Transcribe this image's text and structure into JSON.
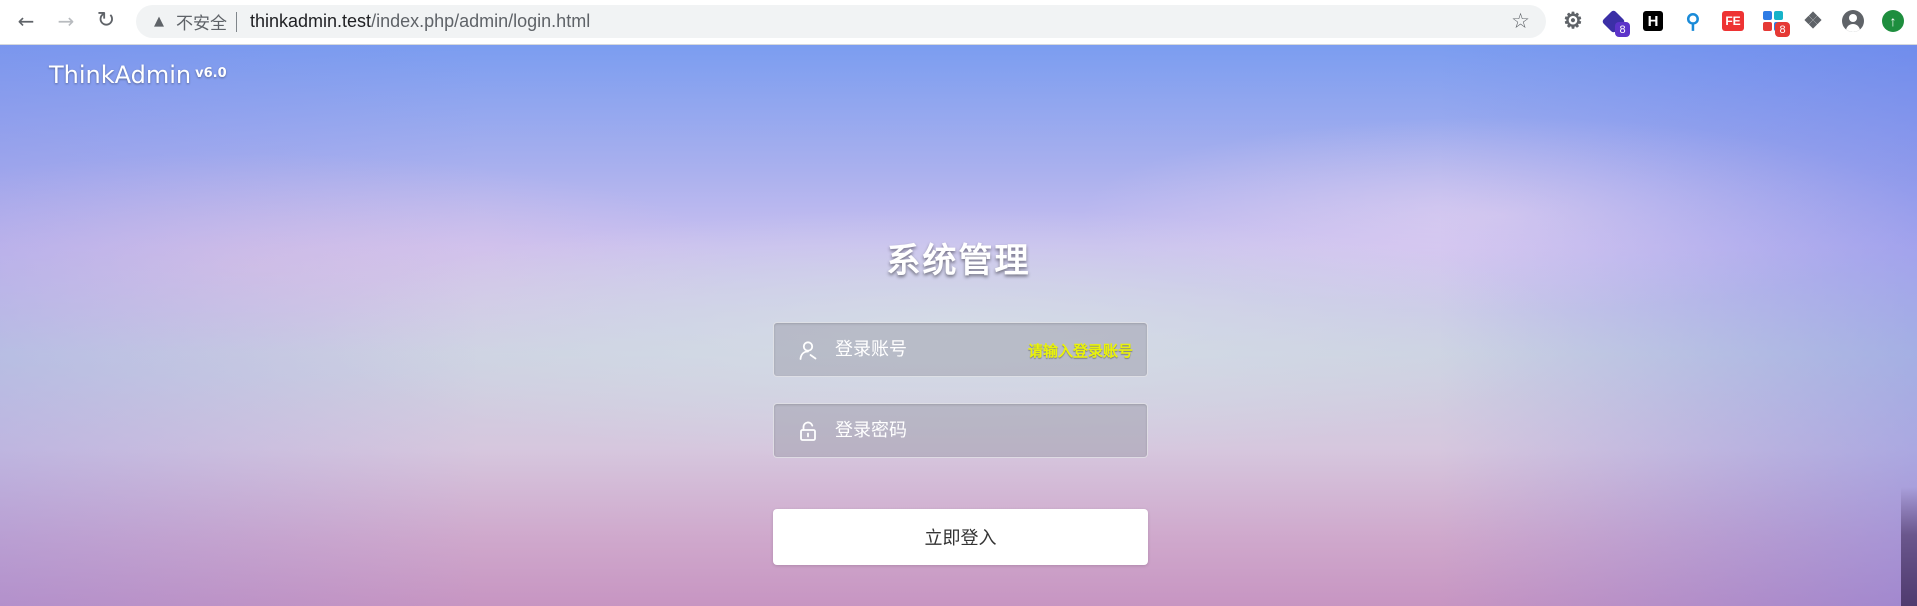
{
  "browser": {
    "security_label": "不安全",
    "url_host": "thinkadmin.test",
    "url_path": "/index.php/admin/login.html",
    "extensions": [
      {
        "name": "settings-extension",
        "badge": ""
      },
      {
        "name": "cube-extension",
        "badge": "8",
        "badge_color": "#5c33c9"
      },
      {
        "name": "h-extension",
        "label": "H",
        "badge": ""
      },
      {
        "name": "pin-extension",
        "badge": ""
      },
      {
        "name": "fe-extension",
        "label": "FE",
        "badge": ""
      },
      {
        "name": "grid-extension",
        "badge": "8",
        "badge_color": "#e53935"
      },
      {
        "name": "puzzle-extension",
        "badge": ""
      },
      {
        "name": "account",
        "badge": ""
      },
      {
        "name": "update",
        "badge": ""
      }
    ]
  },
  "brand": {
    "name": "ThinkAdmin",
    "version": "v6.0"
  },
  "login": {
    "title": "系统管理",
    "username_placeholder": "登录账号",
    "username_error": "请输入登录账号",
    "password_placeholder": "登录密码",
    "submit_label": "立即登入"
  },
  "colors": {
    "error_text": "#e9f20a",
    "button_bg": "#ffffff"
  }
}
